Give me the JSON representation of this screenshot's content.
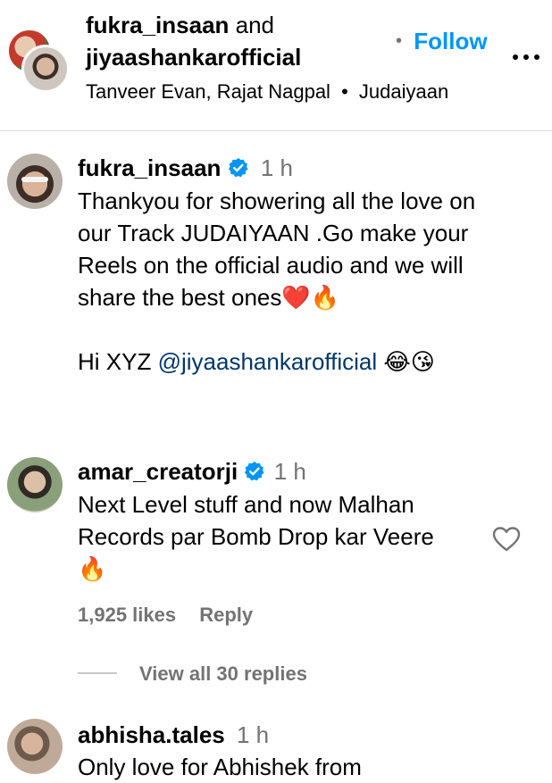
{
  "header": {
    "user1": "fukra_insaan",
    "and_text": "and",
    "user2": "jiyaashankarofficial",
    "dot": "•",
    "follow_label": "Follow",
    "audio_artists": "Tanveer Evan, Rajat Nagpal",
    "audio_sep": "•",
    "audio_track": "Judaiyaan",
    "more_label": "•••"
  },
  "caption": {
    "username": "fukra_insaan",
    "time": "1 h",
    "lines": [
      "Thankyou for showering all the love on",
      "our Track JUDAIYAAN .Go make your",
      "Reels on the official audio and we will",
      "share the best ones"
    ],
    "emoji_end": "❤️🔥",
    "hi_text": "Hi XYZ ",
    "mention": "@jiyaashankarofficial",
    "mention_emoji": " 😂😘"
  },
  "comments": [
    {
      "username": "amar_creatorji",
      "time": "1 h",
      "lines": [
        "Next Level stuff and now Malhan",
        "Records par Bomb Drop kar Veere",
        "🔥"
      ],
      "likes": "1,925 likes",
      "reply_label": "Reply",
      "view_replies": "View all 30 replies"
    },
    {
      "username": "abhisha.tales",
      "time": "1 h",
      "lines": [
        "Only love for Abhishek from"
      ]
    }
  ],
  "colors": {
    "accent": "#0095f6",
    "mention": "#00376b",
    "muted": "#737373",
    "verified": "#0095f6"
  }
}
